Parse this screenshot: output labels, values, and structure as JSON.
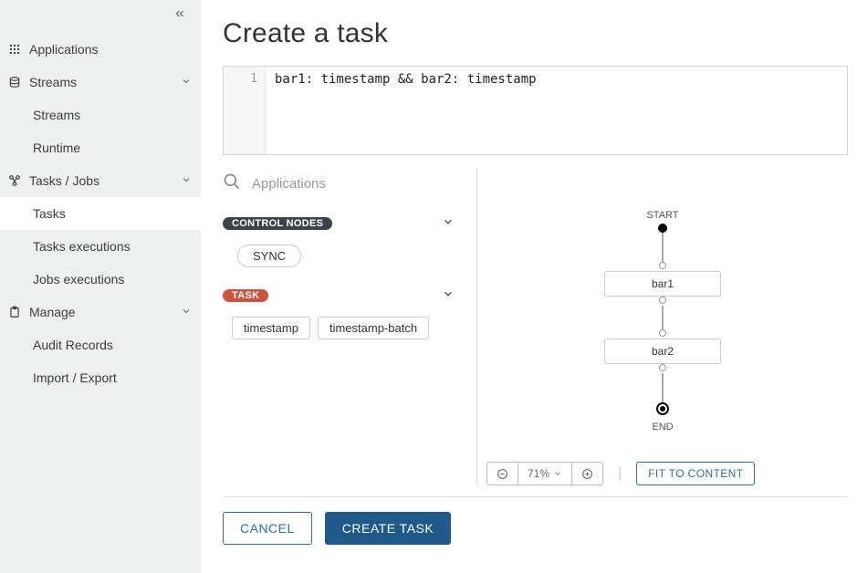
{
  "sidebar": {
    "items": [
      {
        "label": "Applications",
        "icon": "grid"
      },
      {
        "label": "Streams",
        "icon": "streams",
        "expandable": true,
        "children": [
          {
            "label": "Streams"
          },
          {
            "label": "Runtime"
          }
        ]
      },
      {
        "label": "Tasks / Jobs",
        "icon": "tasks",
        "expandable": true,
        "children": [
          {
            "label": "Tasks",
            "active": true
          },
          {
            "label": "Tasks executions"
          },
          {
            "label": "Jobs executions"
          }
        ]
      },
      {
        "label": "Manage",
        "icon": "manage",
        "expandable": true,
        "children": [
          {
            "label": "Audit Records"
          },
          {
            "label": "Import / Export"
          }
        ]
      }
    ]
  },
  "page": {
    "title": "Create a task",
    "editor": {
      "line_number": "1",
      "code": "bar1: timestamp && bar2: timestamp"
    }
  },
  "palette": {
    "search_placeholder": "Applications",
    "groups": [
      {
        "badge": "CONTROL NODES",
        "style": "dark",
        "items": [
          "SYNC"
        ],
        "shape": "pill"
      },
      {
        "badge": "TASK",
        "style": "red",
        "items": [
          "timestamp",
          "timestamp-batch"
        ],
        "shape": "rect"
      }
    ]
  },
  "canvas": {
    "start_label": "START",
    "end_label": "END",
    "nodes": [
      "bar1",
      "bar2"
    ]
  },
  "controls": {
    "zoom_level": "71%",
    "fit_label": "FIT TO CONTENT"
  },
  "footer": {
    "cancel": "CANCEL",
    "create": "CREATE TASK"
  }
}
